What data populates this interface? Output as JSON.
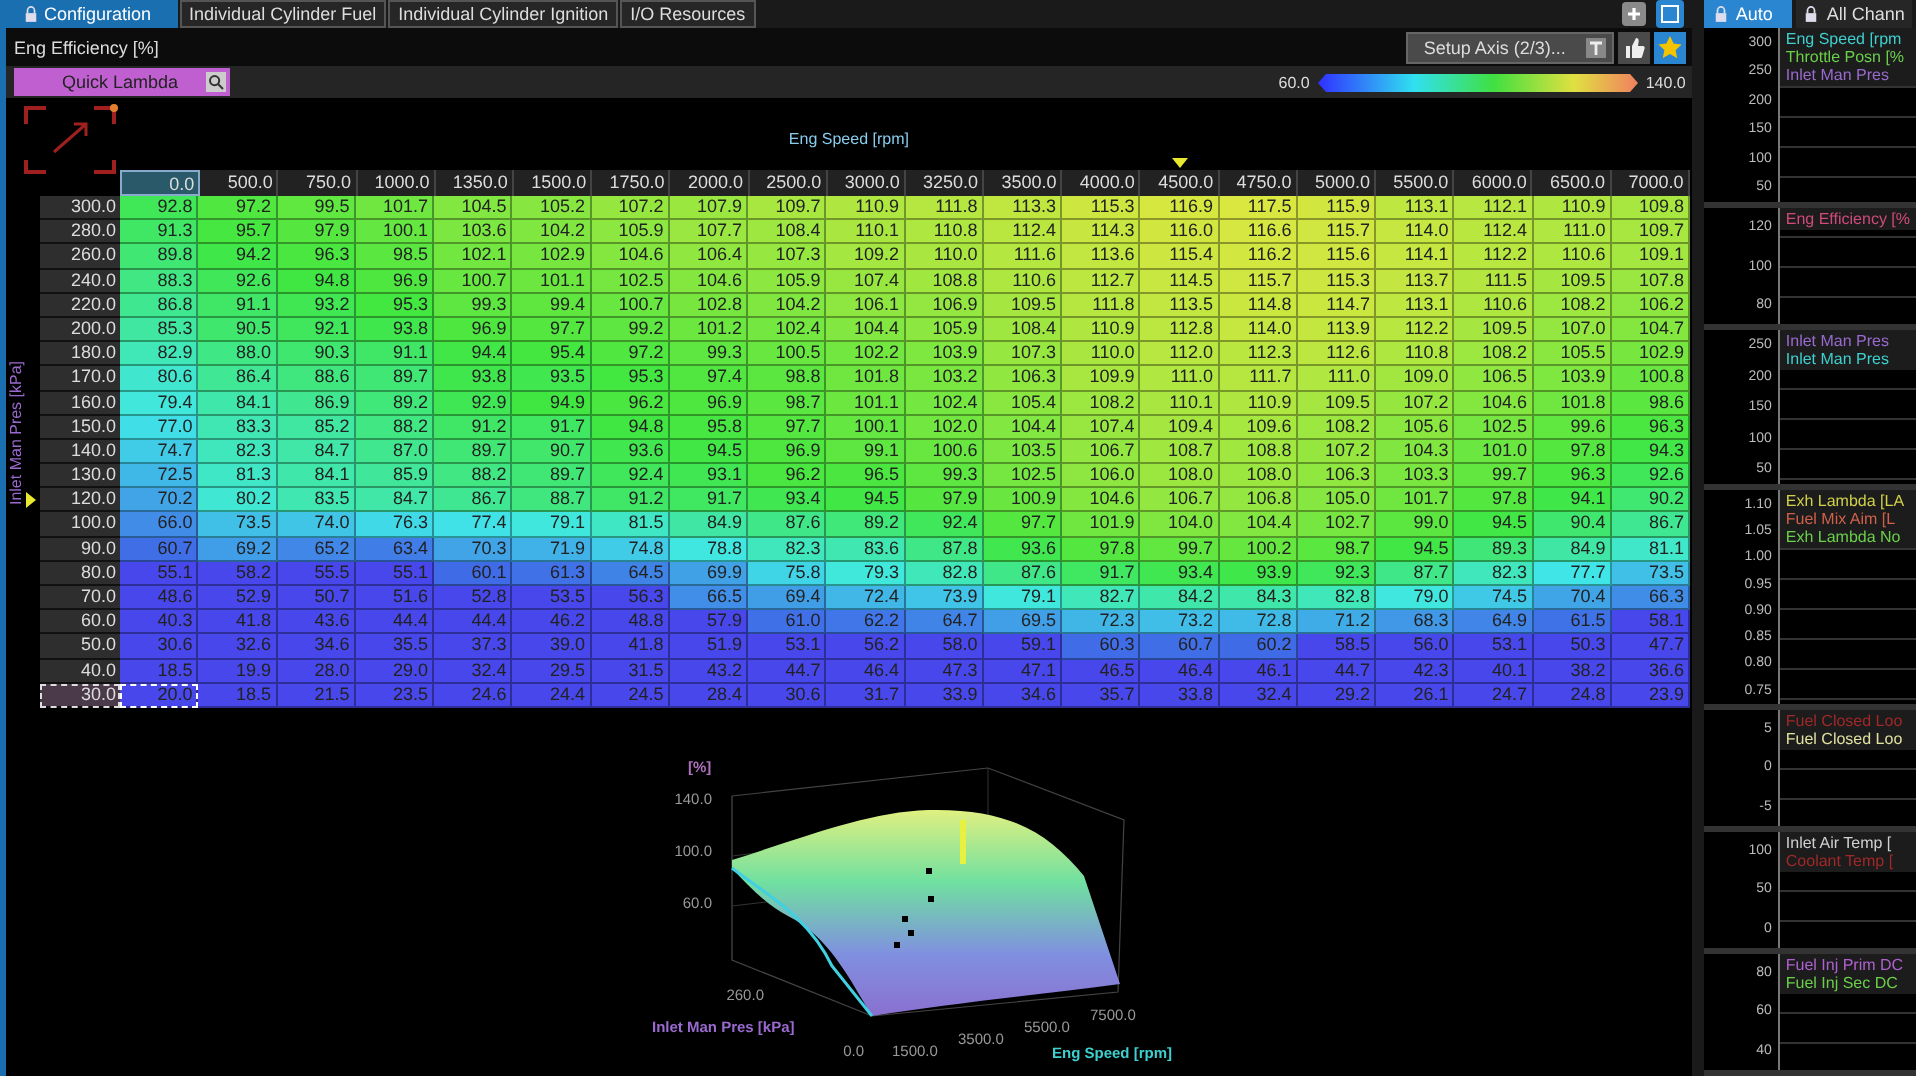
{
  "tabs": [
    {
      "label": "Configuration",
      "selected": true
    },
    {
      "label": "Individual Cylinder Fuel",
      "selected": false
    },
    {
      "label": "Individual Cylinder Ignition",
      "selected": false
    },
    {
      "label": "I/O Resources",
      "selected": false
    }
  ],
  "title": "Eng Efficiency [%]",
  "setup_button": "Setup Axis (2/3)...",
  "quick_lambda": "Quick Lambda",
  "legend": {
    "min": "60.0",
    "max": "140.0"
  },
  "table": {
    "x_axis_label": "Eng Speed [rpm]",
    "y_axis_label": "Inlet Man Pres [kPa]",
    "columns": [
      {
        "label": "0.0",
        "selected": true,
        "marker": false
      },
      {
        "label": "500.0",
        "selected": false,
        "marker": false
      },
      {
        "label": "750.0",
        "selected": false,
        "marker": false
      },
      {
        "label": "1000.0",
        "selected": false,
        "marker": false
      },
      {
        "label": "1350.0",
        "selected": false,
        "marker": false
      },
      {
        "label": "1500.0",
        "selected": false,
        "marker": false
      },
      {
        "label": "1750.0",
        "selected": false,
        "marker": false
      },
      {
        "label": "2000.0",
        "selected": false,
        "marker": false
      },
      {
        "label": "2500.0",
        "selected": false,
        "marker": false
      },
      {
        "label": "3000.0",
        "selected": false,
        "marker": false
      },
      {
        "label": "3250.0",
        "selected": false,
        "marker": false
      },
      {
        "label": "3500.0",
        "selected": false,
        "marker": false
      },
      {
        "label": "4000.0",
        "selected": false,
        "marker": false
      },
      {
        "label": "4500.0",
        "selected": false,
        "marker": true
      },
      {
        "label": "4750.0",
        "selected": false,
        "marker": false
      },
      {
        "label": "5000.0",
        "selected": false,
        "marker": false
      },
      {
        "label": "5500.0",
        "selected": false,
        "marker": false
      },
      {
        "label": "6000.0",
        "selected": false,
        "marker": false
      },
      {
        "label": "6500.0",
        "selected": false,
        "marker": false
      },
      {
        "label": "7000.0",
        "selected": false,
        "marker": false
      }
    ],
    "rows": [
      {
        "axis": "300.0",
        "selected": false,
        "marker": false,
        "cells": [
          "92.8",
          "97.2",
          "99.5",
          "101.7",
          "104.5",
          "105.2",
          "107.2",
          "107.9",
          "109.7",
          "110.9",
          "111.8",
          "113.3",
          "115.3",
          "116.9",
          "117.5",
          "115.9",
          "113.1",
          "112.1",
          "110.9",
          "109.8"
        ]
      },
      {
        "axis": "280.0",
        "selected": false,
        "marker": false,
        "cells": [
          "91.3",
          "95.7",
          "97.9",
          "100.1",
          "103.6",
          "104.2",
          "105.9",
          "107.7",
          "108.4",
          "110.1",
          "110.8",
          "112.4",
          "114.3",
          "116.0",
          "116.6",
          "115.7",
          "114.0",
          "112.4",
          "111.0",
          "109.7"
        ]
      },
      {
        "axis": "260.0",
        "selected": false,
        "marker": false,
        "cells": [
          "89.8",
          "94.2",
          "96.3",
          "98.5",
          "102.1",
          "102.9",
          "104.6",
          "106.4",
          "107.3",
          "109.2",
          "110.0",
          "111.6",
          "113.6",
          "115.4",
          "116.2",
          "115.6",
          "114.1",
          "112.2",
          "110.6",
          "109.1"
        ]
      },
      {
        "axis": "240.0",
        "selected": false,
        "marker": false,
        "cells": [
          "88.3",
          "92.6",
          "94.8",
          "96.9",
          "100.7",
          "101.1",
          "102.5",
          "104.6",
          "105.9",
          "107.4",
          "108.8",
          "110.6",
          "112.7",
          "114.5",
          "115.7",
          "115.3",
          "113.7",
          "111.5",
          "109.5",
          "107.8"
        ]
      },
      {
        "axis": "220.0",
        "selected": false,
        "marker": false,
        "cells": [
          "86.8",
          "91.1",
          "93.2",
          "95.3",
          "99.3",
          "99.4",
          "100.7",
          "102.8",
          "104.2",
          "106.1",
          "106.9",
          "109.5",
          "111.8",
          "113.5",
          "114.8",
          "114.7",
          "113.1",
          "110.6",
          "108.2",
          "106.2"
        ]
      },
      {
        "axis": "200.0",
        "selected": false,
        "marker": false,
        "cells": [
          "85.3",
          "90.5",
          "92.1",
          "93.8",
          "96.9",
          "97.7",
          "99.2",
          "101.2",
          "102.4",
          "104.4",
          "105.9",
          "108.4",
          "110.9",
          "112.8",
          "114.0",
          "113.9",
          "112.2",
          "109.5",
          "107.0",
          "104.7"
        ]
      },
      {
        "axis": "180.0",
        "selected": false,
        "marker": false,
        "cells": [
          "82.9",
          "88.0",
          "90.3",
          "91.1",
          "94.4",
          "95.4",
          "97.2",
          "99.3",
          "100.5",
          "102.2",
          "103.9",
          "107.3",
          "110.0",
          "112.0",
          "112.3",
          "112.6",
          "110.8",
          "108.2",
          "105.5",
          "102.9"
        ]
      },
      {
        "axis": "170.0",
        "selected": false,
        "marker": false,
        "cells": [
          "80.6",
          "86.4",
          "88.6",
          "89.7",
          "93.8",
          "93.5",
          "95.3",
          "97.4",
          "98.8",
          "101.8",
          "103.2",
          "106.3",
          "109.9",
          "111.0",
          "111.7",
          "111.0",
          "109.0",
          "106.5",
          "103.9",
          "100.8"
        ]
      },
      {
        "axis": "160.0",
        "selected": false,
        "marker": false,
        "cells": [
          "79.4",
          "84.1",
          "86.9",
          "89.2",
          "92.9",
          "94.9",
          "96.2",
          "96.9",
          "98.7",
          "101.1",
          "102.4",
          "105.4",
          "108.2",
          "110.1",
          "110.9",
          "109.5",
          "107.2",
          "104.6",
          "101.8",
          "98.6"
        ]
      },
      {
        "axis": "150.0",
        "selected": false,
        "marker": false,
        "cells": [
          "77.0",
          "83.3",
          "85.2",
          "88.2",
          "91.2",
          "91.7",
          "94.8",
          "95.8",
          "97.7",
          "100.1",
          "102.0",
          "104.4",
          "107.4",
          "109.4",
          "109.6",
          "108.2",
          "105.6",
          "102.5",
          "99.6",
          "96.3"
        ]
      },
      {
        "axis": "140.0",
        "selected": false,
        "marker": false,
        "cells": [
          "74.7",
          "82.3",
          "84.7",
          "87.0",
          "89.7",
          "90.7",
          "93.6",
          "94.5",
          "96.9",
          "99.1",
          "100.6",
          "103.5",
          "106.7",
          "108.7",
          "108.8",
          "107.2",
          "104.3",
          "101.0",
          "97.8",
          "94.3"
        ]
      },
      {
        "axis": "130.0",
        "selected": false,
        "marker": false,
        "cells": [
          "72.5",
          "81.3",
          "84.1",
          "85.9",
          "88.2",
          "89.7",
          "92.4",
          "93.1",
          "96.2",
          "96.5",
          "99.3",
          "102.5",
          "106.0",
          "108.0",
          "108.0",
          "106.3",
          "103.3",
          "99.7",
          "96.3",
          "92.6"
        ]
      },
      {
        "axis": "120.0",
        "selected": false,
        "marker": true,
        "cells": [
          "70.2",
          "80.2",
          "83.5",
          "84.7",
          "86.7",
          "88.7",
          "91.2",
          "91.7",
          "93.4",
          "94.5",
          "97.9",
          "100.9",
          "104.6",
          "106.7",
          "106.8",
          "105.0",
          "101.7",
          "97.8",
          "94.1",
          "90.2"
        ]
      },
      {
        "axis": "100.0",
        "selected": false,
        "marker": false,
        "cells": [
          "66.0",
          "73.5",
          "74.0",
          "76.3",
          "77.4",
          "79.1",
          "81.5",
          "84.9",
          "87.6",
          "89.2",
          "92.4",
          "97.7",
          "101.9",
          "104.0",
          "104.4",
          "102.7",
          "99.0",
          "94.5",
          "90.4",
          "86.7"
        ]
      },
      {
        "axis": "90.0",
        "selected": false,
        "marker": false,
        "cells": [
          "60.7",
          "69.2",
          "65.2",
          "63.4",
          "70.3",
          "71.9",
          "74.8",
          "78.8",
          "82.3",
          "83.6",
          "87.8",
          "93.6",
          "97.8",
          "99.7",
          "100.2",
          "98.7",
          "94.5",
          "89.3",
          "84.9",
          "81.1"
        ]
      },
      {
        "axis": "80.0",
        "selected": false,
        "marker": false,
        "cells": [
          "55.1",
          "58.2",
          "55.5",
          "55.1",
          "60.1",
          "61.3",
          "64.5",
          "69.9",
          "75.8",
          "79.3",
          "82.8",
          "87.6",
          "91.7",
          "93.4",
          "93.9",
          "92.3",
          "87.7",
          "82.3",
          "77.7",
          "73.5"
        ]
      },
      {
        "axis": "70.0",
        "selected": false,
        "marker": false,
        "cells": [
          "48.6",
          "52.9",
          "50.7",
          "51.6",
          "52.8",
          "53.5",
          "56.3",
          "66.5",
          "69.4",
          "72.4",
          "73.9",
          "79.1",
          "82.7",
          "84.2",
          "84.3",
          "82.8",
          "79.0",
          "74.5",
          "70.4",
          "66.3"
        ]
      },
      {
        "axis": "60.0",
        "selected": false,
        "marker": false,
        "cells": [
          "40.3",
          "41.8",
          "43.6",
          "44.4",
          "44.4",
          "46.2",
          "48.8",
          "57.9",
          "61.0",
          "62.2",
          "64.7",
          "69.5",
          "72.3",
          "73.2",
          "72.8",
          "71.2",
          "68.3",
          "64.9",
          "61.5",
          "58.1"
        ]
      },
      {
        "axis": "50.0",
        "selected": false,
        "marker": false,
        "cells": [
          "30.6",
          "32.6",
          "34.6",
          "35.5",
          "37.3",
          "39.0",
          "41.8",
          "51.9",
          "53.1",
          "56.2",
          "58.0",
          "59.1",
          "60.3",
          "60.7",
          "60.2",
          "58.5",
          "56.0",
          "53.1",
          "50.3",
          "47.7"
        ]
      },
      {
        "axis": "40.0",
        "selected": false,
        "marker": false,
        "cells": [
          "18.5",
          "19.9",
          "28.0",
          "29.0",
          "32.4",
          "29.5",
          "31.5",
          "43.2",
          "44.7",
          "46.4",
          "47.3",
          "47.1",
          "46.5",
          "46.4",
          "46.1",
          "44.7",
          "42.3",
          "40.1",
          "38.2",
          "36.6"
        ]
      },
      {
        "axis": "30.0",
        "selected": true,
        "marker": false,
        "cells": [
          "20.0",
          "18.5",
          "21.5",
          "23.5",
          "24.6",
          "24.4",
          "24.5",
          "28.4",
          "30.6",
          "31.7",
          "33.9",
          "34.6",
          "35.7",
          "33.8",
          "32.4",
          "29.2",
          "26.1",
          "24.7",
          "24.8",
          "23.9"
        ]
      }
    ]
  },
  "surface_plot": {
    "z_label": "[%]",
    "z_ticks": [
      "140.0",
      "100.0",
      "60.0"
    ],
    "y_label": "Inlet Man Pres [kPa]",
    "y_ticks": [
      "260.0",
      "0.0"
    ],
    "x_label": "Eng Speed [rpm]",
    "x_ticks": [
      "1500.0",
      "3500.0",
      "5500.0",
      "7500.0"
    ]
  },
  "side_tabs": [
    {
      "label": "Auto",
      "selected": true
    },
    {
      "label": "All Chann",
      "selected": false
    }
  ],
  "graphs": [
    {
      "ticks": [
        "300",
        "250",
        "200",
        "150",
        "100",
        "50"
      ],
      "channels": [
        {
          "name": "Eng Speed [rpm",
          "color": "#3ecfcf"
        },
        {
          "name": "Throttle Posn [%",
          "color": "#6ad04a"
        },
        {
          "name": "Inlet Man Pres",
          "color": "#9a6ad0"
        }
      ]
    },
    {
      "ticks": [
        "120",
        "100",
        "80"
      ],
      "channels": [
        {
          "name": "Eng Efficiency [%",
          "color": "#d04a7a"
        }
      ]
    },
    {
      "ticks": [
        "250",
        "200",
        "150",
        "100",
        "50"
      ],
      "channels": [
        {
          "name": "Inlet Man Pres",
          "color": "#9a6ad0"
        },
        {
          "name": "Inlet Man Pres",
          "color": "#3ecfcf"
        }
      ]
    },
    {
      "ticks": [
        "1.10",
        "1.05",
        "1.00",
        "0.95",
        "0.90",
        "0.85",
        "0.80",
        "0.75"
      ],
      "channels": [
        {
          "name": "Exh Lambda [LA",
          "color": "#d0d04a"
        },
        {
          "name": "Fuel Mix Aim [L",
          "color": "#d0604a"
        },
        {
          "name": "Exh Lambda No",
          "color": "#6ad04a"
        }
      ]
    },
    {
      "ticks": [
        "5",
        "0",
        "-5"
      ],
      "channels": [
        {
          "name": "Fuel Closed Loo",
          "color": "#a02828"
        },
        {
          "name": "Fuel Closed Loo",
          "color": "#e0e0a0"
        }
      ]
    },
    {
      "ticks": [
        "100",
        "50",
        "0"
      ],
      "channels": [
        {
          "name": "Inlet Air Temp [",
          "color": "#d0d0d0"
        },
        {
          "name": "Coolant Temp [",
          "color": "#a02828"
        }
      ]
    },
    {
      "ticks": [
        "80",
        "60",
        "40"
      ],
      "channels": [
        {
          "name": "Fuel Inj Prim DC",
          "color": "#b060d0"
        },
        {
          "name": "Fuel Inj Sec DC",
          "color": "#6ad04a"
        }
      ]
    }
  ]
}
